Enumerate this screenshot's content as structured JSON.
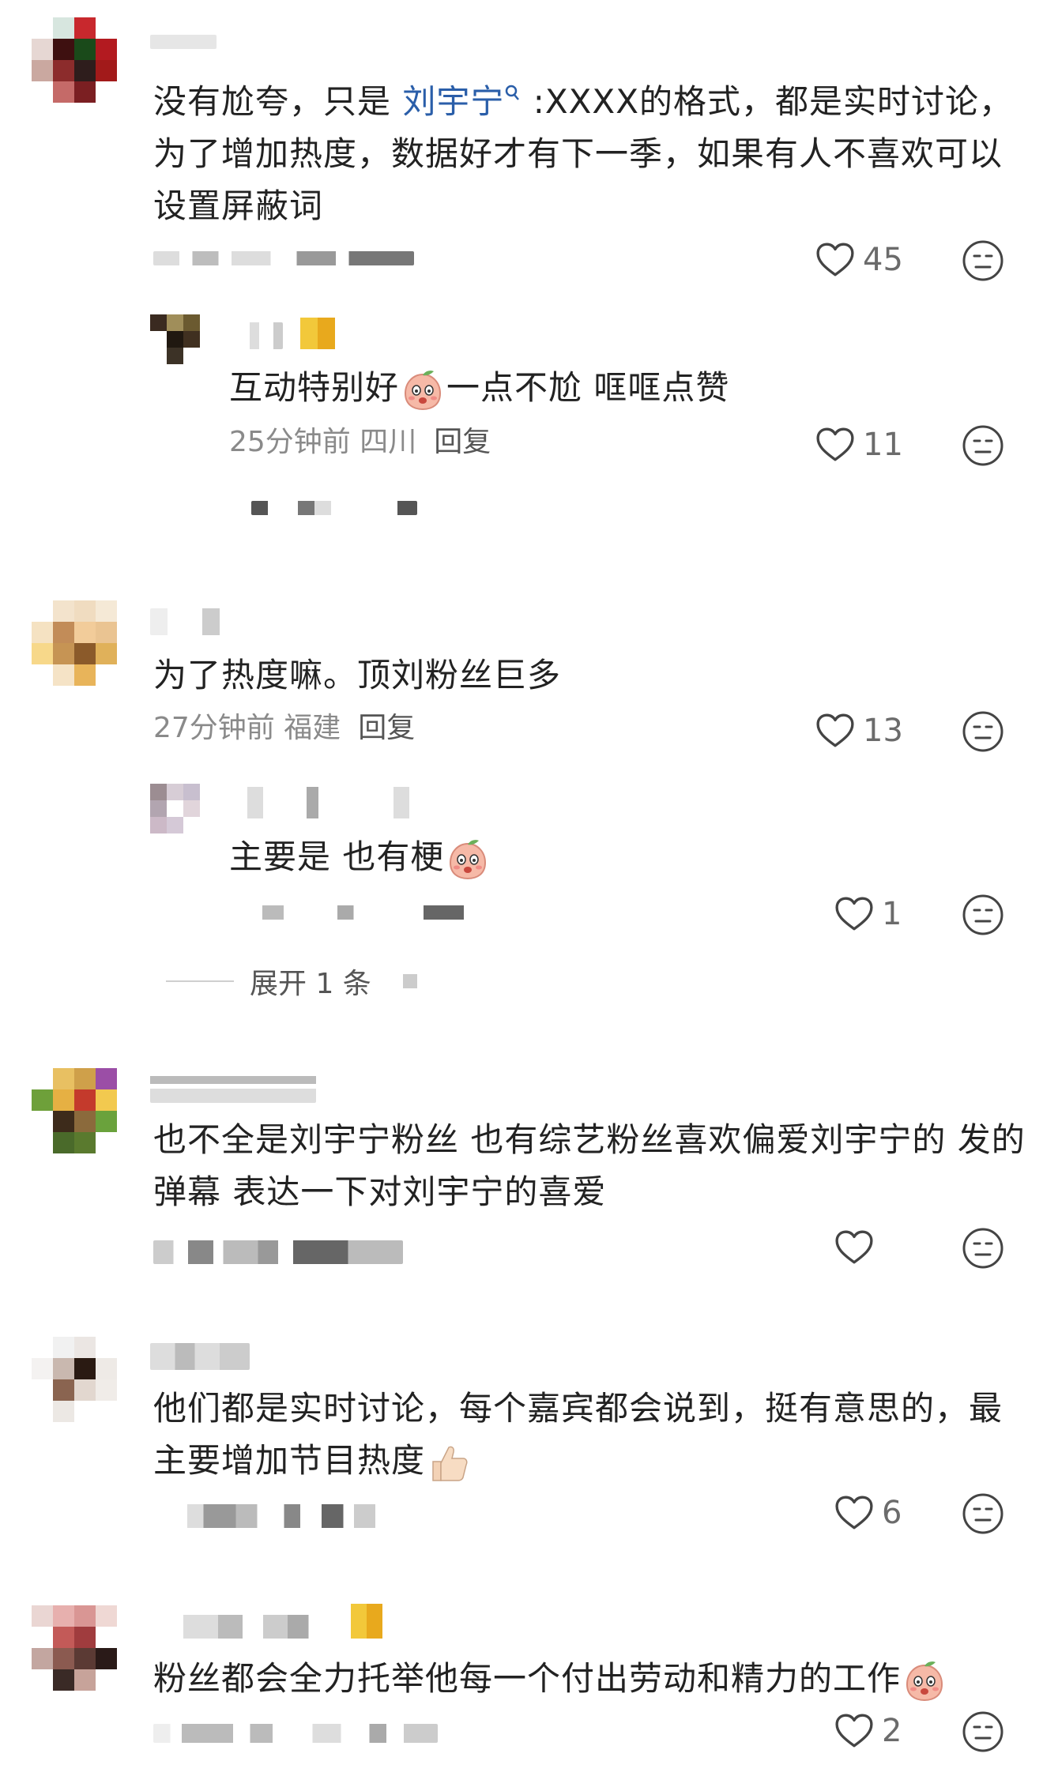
{
  "comments": [
    {
      "text_before": "没有尬夸，只是 ",
      "mention": "刘宇宁",
      "text_line1_after": " :XXXX的格式，都是实时讨论，",
      "text_line2": "为了增加热度，数据好才有下一季，如果有人不喜欢可以",
      "text_line3": "设置屏蔽词",
      "likes": "45",
      "reply": {
        "text": "互动特别好",
        "text_after": "一点不尬 哐哐点赞",
        "time": "25分钟前",
        "location": "四川",
        "reply_label": "回复",
        "likes": "11"
      }
    },
    {
      "text": "为了热度嘛。顶刘粉丝巨多",
      "time": "27分钟前",
      "location": "福建",
      "reply_label": "回复",
      "likes": "13",
      "reply": {
        "text": "主要是 也有梗",
        "likes": "1"
      },
      "expand_label": "展开 1 条"
    },
    {
      "text_line1": "也不全是刘宇宁粉丝 也有综艺粉丝喜欢偏爱刘宇宁的 发的",
      "text_line2": "弹幕  表达一下对刘宇宁的喜爱",
      "likes": ""
    },
    {
      "text_line1": "他们都是实时讨论，每个嘉宾都会说到，挺有意思的，最",
      "text_line2": "主要增加节目热度",
      "likes": "6"
    },
    {
      "text": "粉丝都会全力托举他每一个付出劳动和精力的工作",
      "likes": "2"
    }
  ],
  "icons": {
    "like": "heart-outline-icon",
    "dislike": "neutral-face-icon",
    "search": "search-icon"
  },
  "colors": {
    "mention": "#2a5ea9",
    "meta": "#8a8a8a"
  }
}
